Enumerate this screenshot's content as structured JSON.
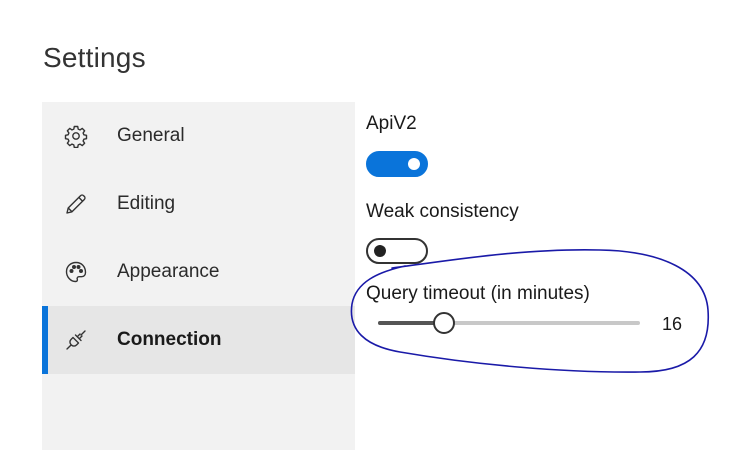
{
  "page": {
    "title": "Settings"
  },
  "sidebar": {
    "items": [
      {
        "label": "General",
        "icon": "gear-icon",
        "selected": false
      },
      {
        "label": "Editing",
        "icon": "pencil-icon",
        "selected": false
      },
      {
        "label": "Appearance",
        "icon": "palette-icon",
        "selected": false
      },
      {
        "label": "Connection",
        "icon": "plug-icon",
        "selected": true
      }
    ]
  },
  "connection": {
    "apiv2": {
      "label": "ApiV2",
      "enabled": true
    },
    "weak_consistency": {
      "label": "Weak consistency",
      "enabled": false
    },
    "query_timeout": {
      "label": "Query timeout (in minutes)",
      "value": "16",
      "fraction": 0.25
    }
  },
  "colors": {
    "accent": "#0a74da",
    "sidebar_bg": "#f2f2f2",
    "selected_bg": "#e6e6e6",
    "annotation": "#1a1aa8"
  }
}
